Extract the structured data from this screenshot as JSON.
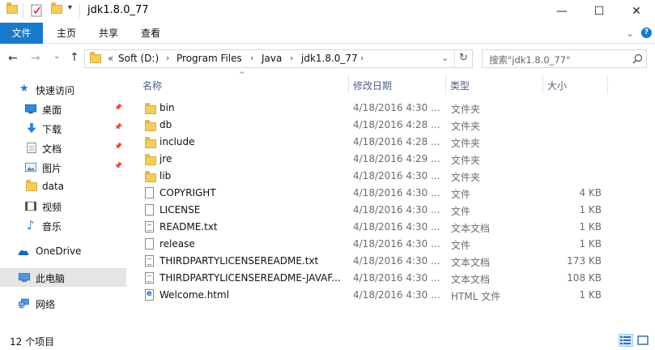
{
  "window": {
    "title": "jdk1.8.0_77",
    "minimize_glyph": "—",
    "maximize_glyph": "☐",
    "close_glyph": "✕"
  },
  "ribbon": {
    "tabs": [
      "文件",
      "主页",
      "共享",
      "查看"
    ],
    "expand_glyph": "⌄",
    "help_glyph": "?"
  },
  "address": {
    "prefix": "«",
    "crumbs": [
      "Soft (D:)",
      "Program Files",
      "Java",
      "jdk1.8.0_77"
    ],
    "separator": "›",
    "dropdown_glyph": "⌄",
    "refresh_glyph": "↻"
  },
  "search": {
    "placeholder": "搜索\"jdk1.8.0_77\""
  },
  "nav": {
    "back_glyph": "←",
    "forward_glyph": "→",
    "recent_glyph": "⌄",
    "up_glyph": "↑",
    "quick_access": "快速访问",
    "items": [
      {
        "label": "桌面",
        "icon": "desktop-icon",
        "pinned": true
      },
      {
        "label": "下载",
        "icon": "download-icon",
        "pinned": true
      },
      {
        "label": "文档",
        "icon": "documents-icon",
        "pinned": true
      },
      {
        "label": "图片",
        "icon": "pictures-icon",
        "pinned": true
      },
      {
        "label": "data",
        "icon": "folder-icon",
        "pinned": false
      },
      {
        "label": "视频",
        "icon": "videos-icon",
        "pinned": false
      },
      {
        "label": "音乐",
        "icon": "music-icon",
        "pinned": false
      }
    ],
    "onedrive": "OneDrive",
    "this_pc": "此电脑",
    "network": "网络",
    "pin_glyph": "📌"
  },
  "list": {
    "columns": {
      "name": "名称",
      "date": "修改日期",
      "type": "类型",
      "size": "大小"
    },
    "sort_glyph": "^",
    "files": [
      {
        "name": "bin",
        "date": "4/18/2016 4:30 ...",
        "type": "文件夹",
        "size": "",
        "kind": "folder"
      },
      {
        "name": "db",
        "date": "4/18/2016 4:28 ...",
        "type": "文件夹",
        "size": "",
        "kind": "folder"
      },
      {
        "name": "include",
        "date": "4/18/2016 4:28 ...",
        "type": "文件夹",
        "size": "",
        "kind": "folder"
      },
      {
        "name": "jre",
        "date": "4/18/2016 4:29 ...",
        "type": "文件夹",
        "size": "",
        "kind": "folder"
      },
      {
        "name": "lib",
        "date": "4/18/2016 4:30 ...",
        "type": "文件夹",
        "size": "",
        "kind": "folder"
      },
      {
        "name": "COPYRIGHT",
        "date": "4/18/2016 4:30 ...",
        "type": "文件",
        "size": "4 KB",
        "kind": "file"
      },
      {
        "name": "LICENSE",
        "date": "4/18/2016 4:30 ...",
        "type": "文件",
        "size": "1 KB",
        "kind": "file"
      },
      {
        "name": "README.txt",
        "date": "4/18/2016 4:30 ...",
        "type": "文本文档",
        "size": "1 KB",
        "kind": "txt"
      },
      {
        "name": "release",
        "date": "4/18/2016 4:30 ...",
        "type": "文件",
        "size": "1 KB",
        "kind": "file"
      },
      {
        "name": "THIRDPARTYLICENSEREADME.txt",
        "date": "4/18/2016 4:30 ...",
        "type": "文本文档",
        "size": "173 KB",
        "kind": "txt"
      },
      {
        "name": "THIRDPARTYLICENSEREADME-JAVAF...",
        "date": "4/18/2016 4:30 ...",
        "type": "文本文档",
        "size": "108 KB",
        "kind": "txt"
      },
      {
        "name": "Welcome.html",
        "date": "4/18/2016 4:30 ...",
        "type": "HTML 文件",
        "size": "1 KB",
        "kind": "html"
      }
    ]
  },
  "status": {
    "item_count": "12 个项目"
  },
  "colors": {
    "accent": "#1979ca",
    "folder": "#f4cd5a",
    "header_text": "#4d6185",
    "selected_nav": "#e5e5e5"
  }
}
